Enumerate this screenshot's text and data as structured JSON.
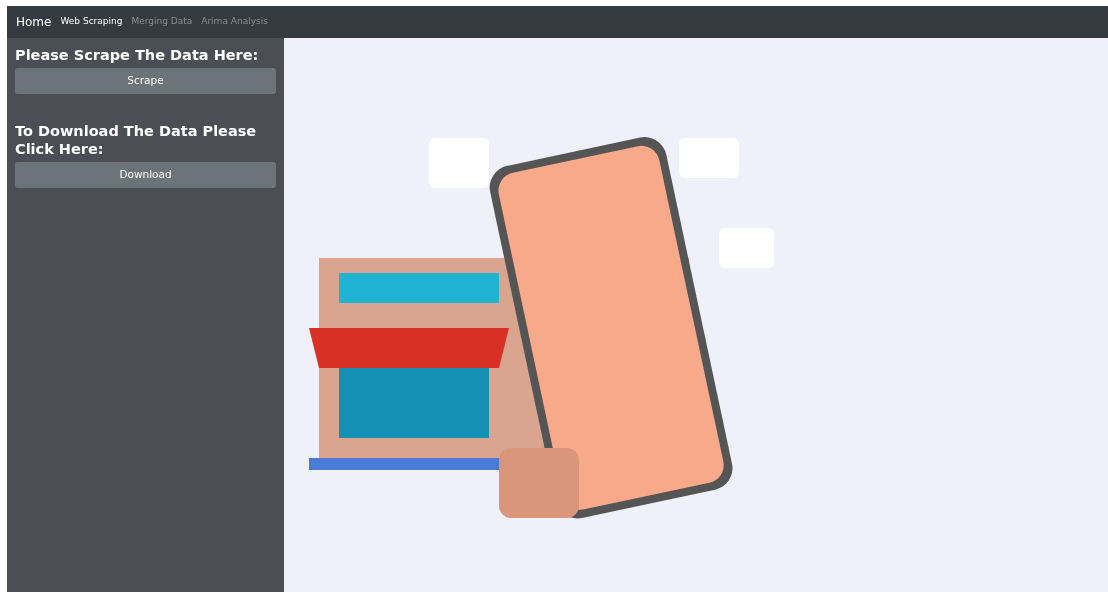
{
  "navbar": {
    "brand": "Home",
    "links": [
      {
        "label": "Web Scraping",
        "selected": true
      },
      {
        "label": "Merging Data",
        "selected": false
      },
      {
        "label": "Arima Analysis",
        "selected": false
      }
    ]
  },
  "sidebar": {
    "sections": [
      {
        "heading": "Please Scrape The Data Here:",
        "button": "Scrape"
      },
      {
        "heading": "To Download The Data Please Click Here:",
        "button": "Download"
      }
    ]
  }
}
